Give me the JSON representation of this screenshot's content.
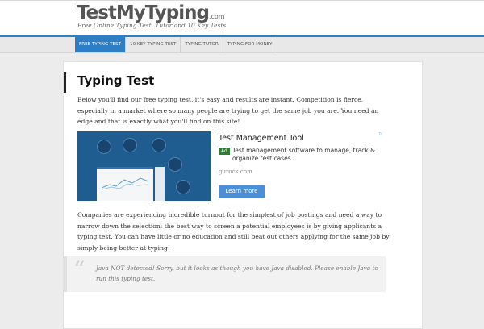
{
  "site": {
    "logo": "TestMyTyping",
    "logo_suffix": ".com",
    "tagline": "Free Online Typing Test, Tutor and 10 Key Tests"
  },
  "nav": {
    "items": [
      {
        "label": "FREE TYPING TEST",
        "active": true
      },
      {
        "label": "10 KEY TYPING TEST",
        "active": false
      },
      {
        "label": "TYPING TUTOR",
        "active": false
      },
      {
        "label": "TYPING FOR MONEY",
        "active": false
      }
    ]
  },
  "main": {
    "title": "Typing Test",
    "intro": "Below you'll find our free typing test, it's easy and results are instant. Competition is fierce, especially in a market where so many people are trying to get the same job you are. You need an edge and that is exactly what you'll find on this site!",
    "body": "Companies are experiencing incredible turnout for the simplest of job postings and need a way to narrow down the selection; the best way to screen a potential employees is by giving applicants a typing test. You can have little or no education and still beat out others applying for the same job by simply being better at typing!",
    "java_notice": "Java NOT detected! Sorry, but it looks as though you have Java disabled. Please enable Java to run this typing test."
  },
  "ad": {
    "title": "Test Management Tool",
    "badge": "Ad",
    "description": "Test management software to manage, track & organize test cases.",
    "url": "gurock.com",
    "button": "Learn more"
  },
  "colors": {
    "accent": "#2d7ec4",
    "ad_badge": "#2e7d32"
  }
}
